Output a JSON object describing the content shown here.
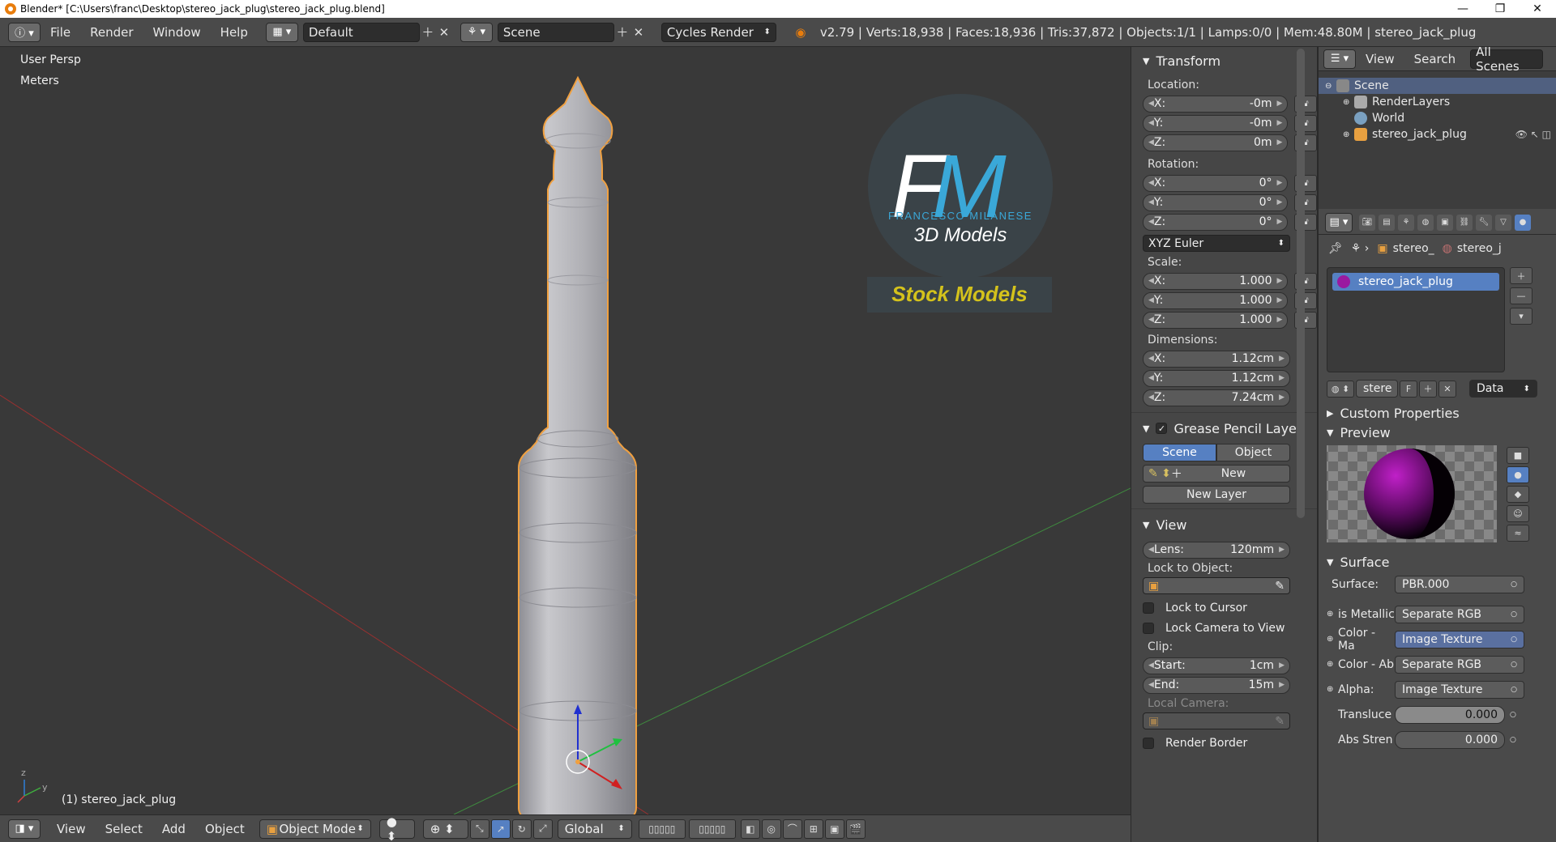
{
  "window": {
    "title": "Blender* [C:\\Users\\franc\\Desktop\\stereo_jack_plug\\stereo_jack_plug.blend]",
    "minimize": "—",
    "maximize": "❐",
    "close": "✕"
  },
  "topbar": {
    "menus": [
      "File",
      "Render",
      "Window",
      "Help"
    ],
    "layout_name": "Default",
    "scene_name": "Scene",
    "render_engine": "Cycles Render",
    "stats": "v2.79 | Verts:18,938 | Faces:18,936 | Tris:37,872 | Objects:1/1 | Lamps:0/0 | Mem:48.80M | stereo_jack_plug"
  },
  "viewport": {
    "view_name": "User Persp",
    "units": "Meters",
    "object_label": "(1) stereo_jack_plug",
    "watermark": {
      "monogram": "FM",
      "name": "FRANCESCO MILANESE",
      "tagline": "3D Models",
      "banner": "Stock Models"
    },
    "colors": {
      "background": "#393939",
      "x_axis": "#9a3030",
      "y_axis": "#3f8a3f",
      "model": "#b8b8bc",
      "selection": "#f0a040",
      "logo_accent": "#3aa8d8",
      "banner_text": "#d4c21c"
    }
  },
  "viewport_header": {
    "menus": [
      "View",
      "Select",
      "Add",
      "Object"
    ],
    "mode": "Object Mode",
    "orientation": "Global"
  },
  "npanel": {
    "transform": {
      "title": "Transform",
      "location_label": "Location:",
      "location": [
        {
          "axis": "X:",
          "value": "-0m"
        },
        {
          "axis": "Y:",
          "value": "-0m"
        },
        {
          "axis": "Z:",
          "value": "0m"
        }
      ],
      "rotation_label": "Rotation:",
      "rotation": [
        {
          "axis": "X:",
          "value": "0°"
        },
        {
          "axis": "Y:",
          "value": "0°"
        },
        {
          "axis": "Z:",
          "value": "0°"
        }
      ],
      "rotation_mode": "XYZ Euler",
      "scale_label": "Scale:",
      "scale": [
        {
          "axis": "X:",
          "value": "1.000"
        },
        {
          "axis": "Y:",
          "value": "1.000"
        },
        {
          "axis": "Z:",
          "value": "1.000"
        }
      ],
      "dimensions_label": "Dimensions:",
      "dimensions": [
        {
          "axis": "X:",
          "value": "1.12cm"
        },
        {
          "axis": "Y:",
          "value": "1.12cm"
        },
        {
          "axis": "Z:",
          "value": "7.24cm"
        }
      ]
    },
    "grease_pencil": {
      "title": "Grease Pencil Layer",
      "scene_tab": "Scene",
      "object_tab": "Object",
      "new_button": "New",
      "new_layer_button": "New Layer"
    },
    "view": {
      "title": "View",
      "lens_label": "Lens:",
      "lens_value": "120mm",
      "lock_to_object_label": "Lock to Object:",
      "lock_to_cursor": "Lock to Cursor",
      "lock_camera": "Lock Camera to View",
      "clip_label": "Clip:",
      "clip_start_label": "Start:",
      "clip_start": "1cm",
      "clip_end_label": "End:",
      "clip_end": "15m",
      "local_camera_label": "Local Camera:",
      "render_border": "Render Border"
    }
  },
  "outliner": {
    "menus": [
      "View",
      "Search"
    ],
    "filter": "All Scenes",
    "items": [
      {
        "label": "Scene",
        "indent": 0
      },
      {
        "label": "RenderLayers",
        "indent": 1
      },
      {
        "label": "World",
        "indent": 1
      },
      {
        "label": "stereo_jack_plug",
        "indent": 1
      }
    ]
  },
  "properties": {
    "breadcrumb": [
      "stereo_",
      "stereo_j"
    ],
    "material_slot": "stereo_jack_plug",
    "material_name_short": "stere",
    "fake_user": "F",
    "link_mode": "Data",
    "custom_properties": "Custom Properties",
    "preview": "Preview",
    "surface_title": "Surface",
    "surface_label": "Surface:",
    "surface_value": "PBR.000",
    "inputs": [
      {
        "label": "is Metallic",
        "value": "Separate RGB"
      },
      {
        "label": "Color - Ma",
        "value": "Image Texture"
      },
      {
        "label": "Color - Ab",
        "value": "Separate RGB"
      },
      {
        "label": "Alpha:",
        "value": "Image Texture"
      }
    ],
    "translucency_label": "Transluce",
    "translucency_value": "0.000",
    "abs_strength_label": "Abs Stren",
    "abs_strength_value": "0.000"
  }
}
